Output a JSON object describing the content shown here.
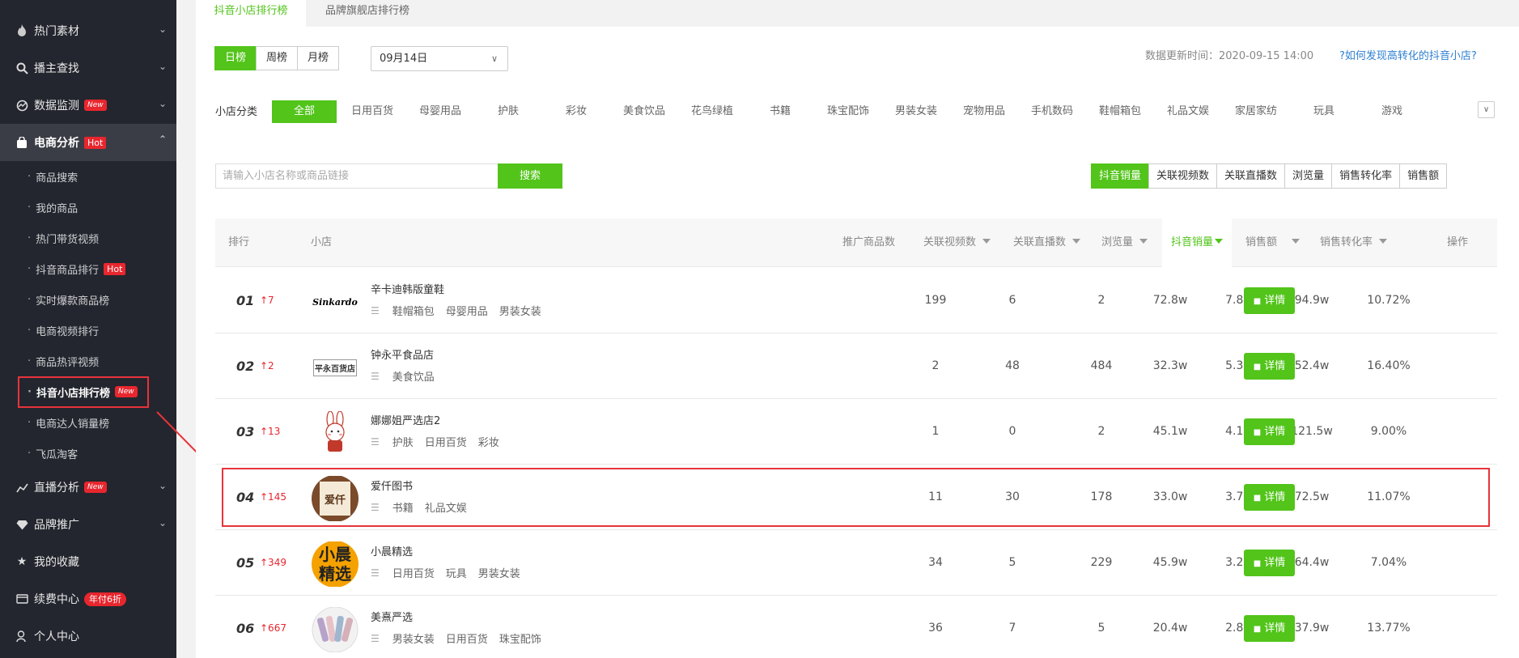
{
  "sidebar": {
    "items": [
      {
        "label": "热门素材",
        "icon": "fire-icon"
      },
      {
        "label": "播主查找",
        "icon": "search-icon"
      },
      {
        "label": "数据监测",
        "icon": "monitor-icon",
        "badge": "New"
      },
      {
        "label": "电商分析",
        "icon": "bag-icon",
        "badge": "Hot"
      },
      {
        "label": "直播分析",
        "icon": "chart-icon",
        "badge": "New"
      },
      {
        "label": "品牌推广",
        "icon": "diamond-icon"
      },
      {
        "label": "我的收藏",
        "icon": "star-icon"
      },
      {
        "label": "续费中心",
        "icon": "card-icon",
        "badge": "年付6折"
      },
      {
        "label": "个人中心",
        "icon": "user-icon"
      }
    ],
    "subitems": [
      "商品搜索",
      "我的商品",
      "热门带货视频",
      "抖音商品排行",
      "实时爆款商品榜",
      "电商视频排行",
      "商品热评视频",
      "抖音小店排行榜",
      "电商达人销量榜",
      "飞瓜淘客"
    ],
    "sub_badge_hot": "Hot",
    "sub_badge_new": "New"
  },
  "tabs": [
    "抖音小店排行榜",
    "品牌旗舰店排行榜"
  ],
  "period_buttons": [
    "日榜",
    "周榜",
    "月榜"
  ],
  "date_select": "09月14日",
  "update_time": "数据更新时间：2020-09-15 14:00",
  "help_link": "?如何发现高转化的抖音小店?",
  "category_label": "小店分类",
  "categories": [
    "全部",
    "日用百货",
    "母婴用品",
    "护肤",
    "彩妆",
    "美食饮品",
    "花鸟绿植",
    "书籍",
    "珠宝配饰",
    "男装女装",
    "宠物用品",
    "手机数码",
    "鞋帽箱包",
    "礼品文娱",
    "家居家纺",
    "玩具",
    "游戏"
  ],
  "search": {
    "placeholder": "请输入小店名称或商品链接",
    "button": "搜索"
  },
  "sort_buttons": [
    "抖音销量",
    "关联视频数",
    "关联直播数",
    "浏览量",
    "销售转化率",
    "销售额"
  ],
  "columns": {
    "rank": "排行",
    "shop": "小店",
    "products": "推广商品数",
    "videos": "关联视频数",
    "lives": "关联直播数",
    "views": "浏览量",
    "sales": "抖音销量",
    "revenue": "销售额",
    "conversion": "销售转化率",
    "action": "操作"
  },
  "detail_label": "详情",
  "rows": [
    {
      "rank": "01",
      "delta": "↑7",
      "name": "辛卡迪韩版童鞋",
      "tags": [
        "鞋帽箱包",
        "母婴用品",
        "男装女装"
      ],
      "products": "199",
      "videos": "6",
      "lives": "2",
      "views": "72.8w",
      "sales": "7.8w",
      "revenue": "94.9w",
      "conversion": "10.72%",
      "logo_text": "Sinkardo"
    },
    {
      "rank": "02",
      "delta": "↑2",
      "name": "钟永平食品店",
      "tags": [
        "美食饮品"
      ],
      "products": "2",
      "videos": "48",
      "lives": "484",
      "views": "32.3w",
      "sales": "5.3w",
      "revenue": "52.4w",
      "conversion": "16.40%",
      "logo_text": "平永百货店"
    },
    {
      "rank": "03",
      "delta": "↑13",
      "name": "娜娜姐严选店2",
      "tags": [
        "护肤",
        "日用百货",
        "彩妆"
      ],
      "products": "1",
      "videos": "0",
      "lives": "2",
      "views": "45.1w",
      "sales": "4.1w",
      "revenue": "121.5w",
      "conversion": "9.00%",
      "logo_text": ""
    },
    {
      "rank": "04",
      "delta": "↑145",
      "name": "爱仟图书",
      "tags": [
        "书籍",
        "礼品文娱"
      ],
      "products": "11",
      "videos": "30",
      "lives": "178",
      "views": "33.0w",
      "sales": "3.7w",
      "revenue": "72.5w",
      "conversion": "11.07%",
      "logo_text": "爱仟"
    },
    {
      "rank": "05",
      "delta": "↑349",
      "name": "小晨精选",
      "tags": [
        "日用百货",
        "玩具",
        "男装女装"
      ],
      "products": "34",
      "videos": "5",
      "lives": "229",
      "views": "45.9w",
      "sales": "3.2w",
      "revenue": "64.4w",
      "conversion": "7.04%",
      "logo_text": "小晨精选"
    },
    {
      "rank": "06",
      "delta": "↑667",
      "name": "美熹严选",
      "tags": [
        "男装女装",
        "日用百货",
        "珠宝配饰"
      ],
      "products": "36",
      "videos": "7",
      "lives": "5",
      "views": "20.4w",
      "sales": "2.8w",
      "revenue": "37.9w",
      "conversion": "13.77%",
      "logo_text": ""
    }
  ],
  "colors": {
    "accent": "#52c41a",
    "sidebar_bg": "#23262e",
    "badge": "#e8262e",
    "highlight": "#e8333b",
    "link": "#2d7fd0"
  }
}
